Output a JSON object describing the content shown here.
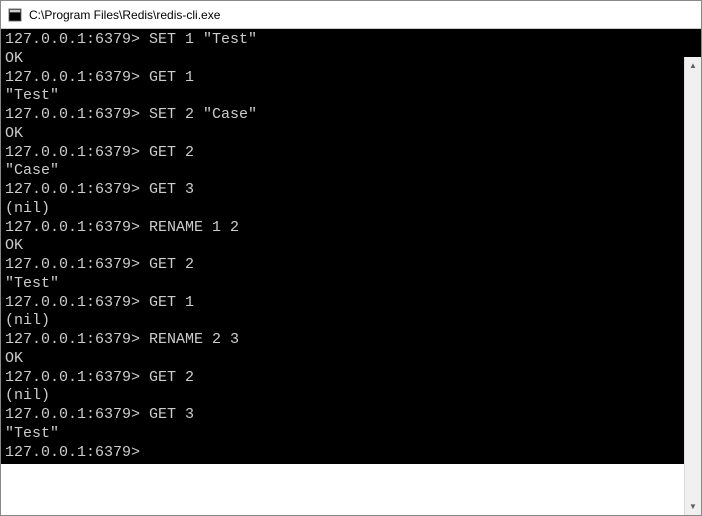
{
  "window": {
    "title": "C:\\Program Files\\Redis\\redis-cli.exe"
  },
  "terminal": {
    "prompt": "127.0.0.1:6379>",
    "lines": [
      {
        "prompt": true,
        "cmd": " SET 1 \"Test\""
      },
      {
        "prompt": false,
        "out": "OK"
      },
      {
        "prompt": true,
        "cmd": " GET 1"
      },
      {
        "prompt": false,
        "out": "\"Test\""
      },
      {
        "prompt": true,
        "cmd": " SET 2 \"Case\""
      },
      {
        "prompt": false,
        "out": "OK"
      },
      {
        "prompt": true,
        "cmd": " GET 2"
      },
      {
        "prompt": false,
        "out": "\"Case\""
      },
      {
        "prompt": true,
        "cmd": " GET 3"
      },
      {
        "prompt": false,
        "out": "(nil)"
      },
      {
        "prompt": true,
        "cmd": " RENAME 1 2"
      },
      {
        "prompt": false,
        "out": "OK"
      },
      {
        "prompt": true,
        "cmd": " GET 2"
      },
      {
        "prompt": false,
        "out": "\"Test\""
      },
      {
        "prompt": true,
        "cmd": " GET 1"
      },
      {
        "prompt": false,
        "out": "(nil)"
      },
      {
        "prompt": true,
        "cmd": " RENAME 2 3"
      },
      {
        "prompt": false,
        "out": "OK"
      },
      {
        "prompt": true,
        "cmd": " GET 2"
      },
      {
        "prompt": false,
        "out": "(nil)"
      },
      {
        "prompt": true,
        "cmd": " GET 3"
      },
      {
        "prompt": false,
        "out": "\"Test\""
      },
      {
        "prompt": true,
        "cmd": ""
      }
    ]
  },
  "scrollbar": {
    "up": "▲",
    "down": "▼"
  }
}
